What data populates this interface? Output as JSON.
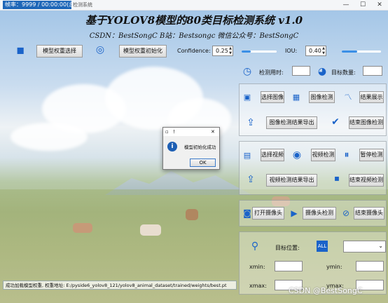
{
  "window": {
    "fps_text": "帧率：9999 / 00:00:00(总)",
    "app_name": "检测系统",
    "minimize": "—",
    "maximize": "☐",
    "close": "✕"
  },
  "header": {
    "title": "基于YOLOV8模型的80类目标检测系统 v1.0",
    "subtitle": "CSDN：BestSongC   B站：Bestsongc   微信公众号：BestSongC"
  },
  "toolbar": {
    "select_weights": "模型权重选择",
    "init_weights": "模型权重初始化",
    "confidence_label": "Confidence:",
    "confidence_value": "0.25",
    "confidence_fraction": 0.25,
    "iou_label": "IOU:",
    "iou_value": "0.40",
    "iou_fraction": 0.4
  },
  "stats": {
    "time_label": "检测用时:",
    "time_value": "",
    "count_label": "目标数量:",
    "count_value": ""
  },
  "image_panel": {
    "select_image": "选择图像",
    "detect_image": "图像检测",
    "show_result": "结果展示",
    "export_image": "图像检测结果导出",
    "end_image": "结束图像检测"
  },
  "video_panel": {
    "select_video": "选择视频",
    "detect_video": "视频检测",
    "pause_detect": "暂停检测",
    "export_video": "视频检测结果导出",
    "end_video": "结束视频检测"
  },
  "camera_panel": {
    "open_camera": "打开摄像头",
    "camera_detect": "摄像头检测",
    "end_camera": "结束摄像头"
  },
  "target_panel": {
    "position_label": "目标位置:",
    "all_badge": "ALL",
    "xmin_label": "xmin:",
    "ymin_label": "ymin:",
    "xmax_label": "xmax:",
    "ymax_label": "ymax:"
  },
  "dialog": {
    "title": "!",
    "close": "✕",
    "message": "模型初始化成功",
    "ok": "OK"
  },
  "status": {
    "text": "成功加载模型权重, 权重地址: E:/pyside6_yolov8_121/yolov8_animal_dataset/trained/weights/best.pt"
  },
  "watermark": "CSDN @BestSongC",
  "colors": {
    "accent": "#1a63c9",
    "slider": "#3b8fe6",
    "fps_bar": "#1e67b8"
  }
}
